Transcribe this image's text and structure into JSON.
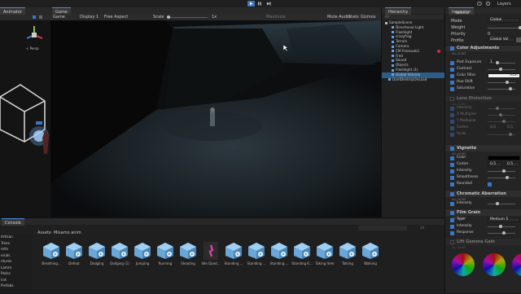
{
  "toolbar": {
    "layers_label": "Layers"
  },
  "animator": {
    "tab": "Animator",
    "persp": "< Persp"
  },
  "game": {
    "tab": "Game",
    "mode": "Game",
    "display": "Display 1",
    "aspect": "Free Aspect",
    "scale_label": "Scale",
    "scale_value": "1x",
    "maximize": "Maximize",
    "mute": "Mute Audio",
    "stats": "Stats",
    "gizmos": "Gizmos"
  },
  "hierarchy": {
    "tab": "Hierarchy",
    "search_placeholder": "All",
    "items": [
      {
        "label": "SampleScene",
        "indent": 0
      },
      {
        "label": "Directional Light",
        "indent": 2
      },
      {
        "label": "Flashlight",
        "indent": 2
      },
      {
        "label": "crazyfrog",
        "indent": 2
      },
      {
        "label": "Terrain",
        "indent": 2
      },
      {
        "label": "Camera",
        "indent": 2
      },
      {
        "label": "CM FreeLook1",
        "indent": 2
      },
      {
        "label": "Fred",
        "indent": 2
      },
      {
        "label": "Sound",
        "indent": 2
      },
      {
        "label": "Objects",
        "indent": 2
      },
      {
        "label": "Flashlight (1)",
        "indent": 2
      },
      {
        "label": "Global Volume",
        "indent": 2
      },
      {
        "label": "DontDestroyOnLoad",
        "indent": 1
      }
    ]
  },
  "inspector": {
    "tab": "Inspector",
    "object": "Volume",
    "mode_label": "Mode",
    "mode_value": "Global",
    "weight_label": "Weight",
    "priority_label": "Priority",
    "priority_value": "0",
    "profile_label": "Profile",
    "profile_value": "Global Vol",
    "color_adjustments": {
      "title": "Color Adjustments",
      "all_none": "ALL NONE",
      "rows": [
        {
          "label": "Post Exposure",
          "value": "1"
        },
        {
          "label": "Contrast",
          "value": ""
        },
        {
          "label": "Color Filter",
          "value": "HDR"
        },
        {
          "label": "Hue Shift",
          "value": ""
        },
        {
          "label": "Saturation",
          "value": ""
        }
      ]
    },
    "lens_distortion": {
      "title": "Lens Distortion",
      "all_none": "ALL NONE",
      "rows": [
        {
          "label": "Intensity"
        },
        {
          "label": "X Multiplier"
        },
        {
          "label": "Y Multiplier"
        },
        {
          "label": "Center",
          "x": "0.5",
          "y": "0.5"
        },
        {
          "label": "Scale"
        }
      ]
    },
    "vignette": {
      "title": "Vignette",
      "all_none": "ALL NONE",
      "rows": [
        {
          "label": "Color"
        },
        {
          "label": "Center",
          "x": "0.5",
          "y": "0.5"
        },
        {
          "label": "Intensity"
        },
        {
          "label": "Smoothness"
        },
        {
          "label": "Rounded"
        }
      ]
    },
    "chromatic": {
      "title": "Chromatic Aberration",
      "all_none": "ALL NONE",
      "rows": [
        {
          "label": "Intensity"
        }
      ]
    },
    "film_grain": {
      "title": "Film Grain",
      "all_none": "ALL NONE",
      "rows": [
        {
          "label": "Type",
          "value": "Medium 5"
        },
        {
          "label": "Intensity"
        },
        {
          "label": "Response"
        }
      ]
    },
    "lift": {
      "title": "Lift Gamma Gain",
      "all_none": "ALL NONE"
    }
  },
  "console": {
    "tab": "Console"
  },
  "project": {
    "breadcrumb_root": "Assets",
    "breadcrumb_sep": ">",
    "breadcrumb_folder": "Mixamo anim",
    "count": "24",
    "folders": [
      "Artisan",
      "Trees",
      "mits",
      "erials",
      "ntures",
      "Lamm",
      "Packs",
      "ind",
      "Prefabs"
    ],
    "assets": [
      "Breathing...",
      "Defeat",
      "Dodging",
      "Dodging (1)",
      "Jumping",
      "Running",
      "Shooting",
      "Idle Dand...",
      "Standing ...",
      "Standing ...",
      "Standing ...",
      "Standing R...",
      "Taking Item",
      "Talking",
      "Walking"
    ]
  },
  "colors": {
    "accent": "#3a76c4",
    "selected": "#2c5d87",
    "highlight": "#d040a8"
  }
}
